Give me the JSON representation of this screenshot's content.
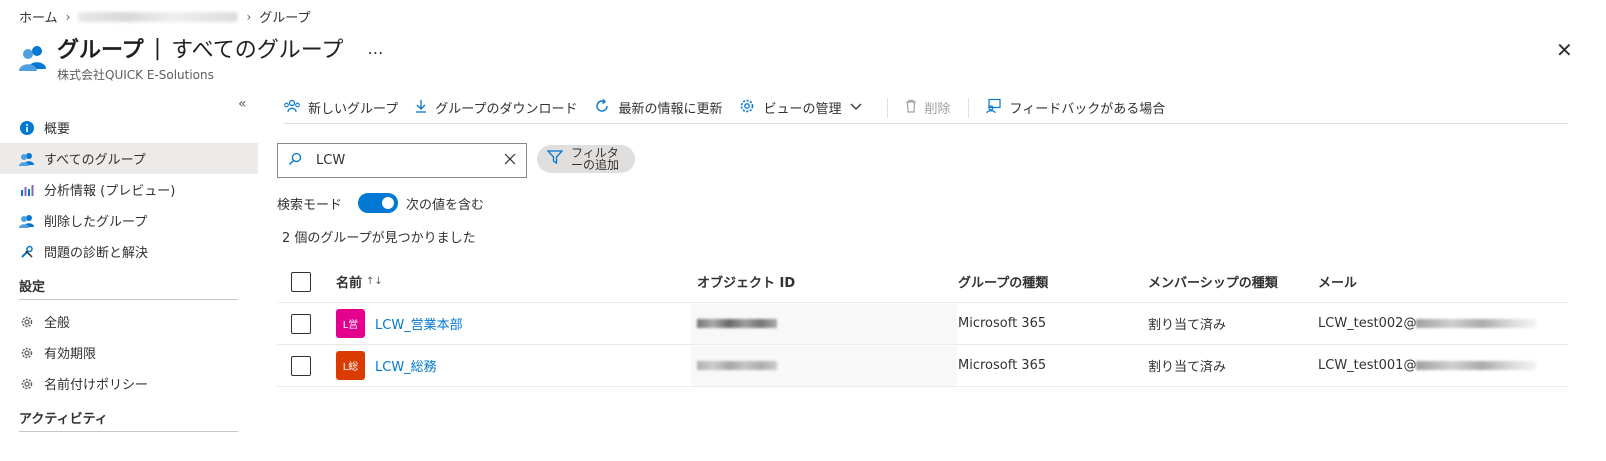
{
  "breadcrumb": {
    "home": "ホーム",
    "current": "グループ"
  },
  "header": {
    "title": "グループ",
    "separator": "|",
    "subtitle": "すべてのグループ",
    "more": "…",
    "org": "株式会社QUICK E-Solutions"
  },
  "close": "✕",
  "sidebar": {
    "collapse": "«",
    "items": [
      {
        "label": "概要"
      },
      {
        "label": "すべてのグループ"
      },
      {
        "label": "分析情報 (プレビュー)"
      },
      {
        "label": "削除したグループ"
      },
      {
        "label": "問題の診断と解決"
      }
    ],
    "settings_heading": "設定",
    "settings_items": [
      {
        "label": "全般"
      },
      {
        "label": "有効期限"
      },
      {
        "label": "名前付けポリシー"
      }
    ],
    "activity_heading": "アクティビティ"
  },
  "toolbar": {
    "new_group": "新しいグループ",
    "download": "グループのダウンロード",
    "refresh": "最新の情報に更新",
    "manage_view": "ビューの管理",
    "delete": "削除",
    "feedback": "フィードバックがある場合"
  },
  "search": {
    "value": "LCW"
  },
  "filter": {
    "label_line1": "フィルタ",
    "label_line2": "ーの追加"
  },
  "search_mode": {
    "label": "検索モード",
    "value_label": "次の値を含む",
    "enabled": true
  },
  "result_count": "2 個のグループが見つかりました",
  "table": {
    "headers": {
      "name": "名前",
      "sort": "↑↓",
      "object_id": "オブジェクト ID",
      "group_type": "グループの種類",
      "membership_type": "メンバーシップの種類",
      "mail": "メール"
    },
    "rows": [
      {
        "avatar": "L営",
        "avatar_color": "#e3008c",
        "name": "LCW_営業本部",
        "group_type": "Microsoft 365",
        "membership_type": "割り当て済み",
        "mail": "LCW_test002@"
      },
      {
        "avatar": "L総",
        "avatar_color": "#da3b01",
        "name": "LCW_総務",
        "group_type": "Microsoft 365",
        "membership_type": "割り当て済み",
        "mail": "LCW_test001@"
      }
    ]
  },
  "colors": {
    "accent": "#0078d4",
    "active_bg": "#edebe9"
  }
}
